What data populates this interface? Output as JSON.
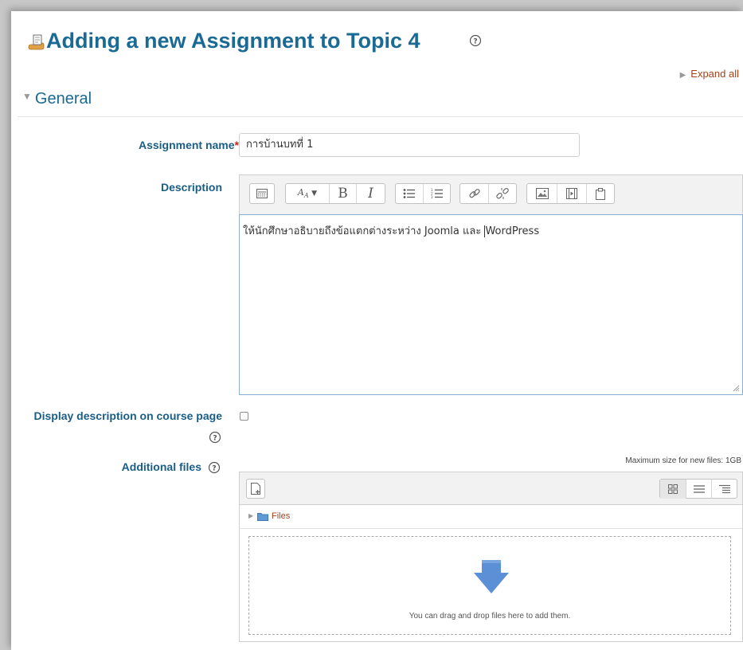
{
  "header": {
    "title": "Adding a new Assignment to Topic 4",
    "expand_all": "Expand all"
  },
  "section": {
    "title": "General"
  },
  "fields": {
    "assignment_name_label": "Assignment name",
    "required_mark": "*",
    "assignment_name_value": "การบ้านบทที่ 1",
    "description_label": "Description",
    "description_text_before_cursor": "ให้นักศึกษาอธิบายถึงข้อแตกต่างระหว่าง Joomla และ ",
    "description_text_after_cursor": "WordPress",
    "display_description_label": "Display description on course page",
    "display_description_checked": false,
    "additional_files_label": "Additional files"
  },
  "editor_toolbar": {
    "icons": [
      "toolbar-toggle-icon",
      "font-color-icon",
      "bold-icon",
      "italic-icon",
      "unordered-list-icon",
      "ordered-list-icon",
      "link-icon",
      "unlink-icon",
      "image-icon",
      "media-icon",
      "manage-files-icon"
    ],
    "bold_glyph": "B",
    "italic_glyph": "I"
  },
  "filemanager": {
    "max_size": "Maximum size for new files: 1GB",
    "path_label": "Files",
    "drop_text": "You can drag and drop files here to add them.",
    "views": [
      "icons-view-icon",
      "list-view-icon",
      "tree-view-icon"
    ]
  },
  "colors": {
    "title": "#1a6a93",
    "label": "#1a5e86",
    "link": "#a3421a",
    "required": "#cc2222",
    "drop_arrow": "#5b8fd6"
  }
}
